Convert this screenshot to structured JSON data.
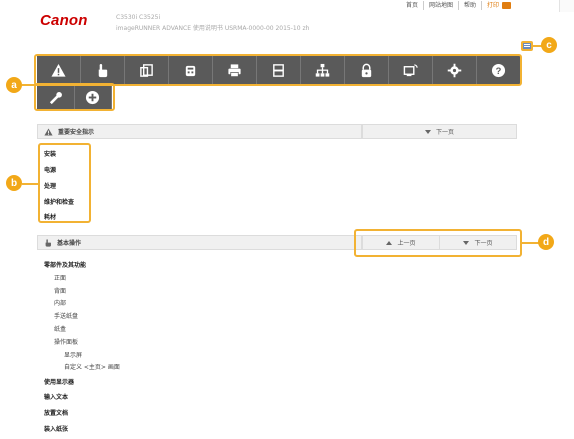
{
  "header": {
    "logo": "Canon",
    "model_line1": "C3530i  C3525i",
    "model_line2": "imageRUNNER ADVANCE  使用说明书  USRMA-0000-00  2015-10  zh",
    "links": [
      "首页",
      "网站地图",
      "帮助",
      "打印"
    ]
  },
  "toolbar": {
    "icons": [
      "warning-icon",
      "hand-icon",
      "copy-icon",
      "fax-icon",
      "print-icon",
      "scan-icon",
      "network-icon",
      "security-icon",
      "remote-ui-icon",
      "settings-icon",
      "help-icon"
    ],
    "row2_icons": [
      "wrench-icon",
      "plus-circle-icon"
    ]
  },
  "callouts": {
    "a": "a",
    "b": "b",
    "c": "c",
    "d": "d"
  },
  "section_safety": {
    "title": "重要安全指示",
    "next": "下一页",
    "items": [
      "安装",
      "电源",
      "处理",
      "维护和检查",
      "耗材"
    ]
  },
  "section_basic": {
    "title": "基本操作",
    "prev": "上一页",
    "next": "下一页",
    "items": [
      {
        "text": "零部件及其功能",
        "level": 0
      },
      {
        "text": "正面",
        "level": 1
      },
      {
        "text": "背面",
        "level": 1
      },
      {
        "text": "内部",
        "level": 1
      },
      {
        "text": "手送纸盘",
        "level": 1
      },
      {
        "text": "纸盒",
        "level": 1
      },
      {
        "text": "操作面板",
        "level": 1
      },
      {
        "text": "显示屏",
        "level": 2
      },
      {
        "text": "自定义 <主页> 画面",
        "level": 2
      },
      {
        "text": "使用显示器",
        "level": 0
      },
      {
        "text": "输入文本",
        "level": 0
      },
      {
        "text": "放置文档",
        "level": 0
      },
      {
        "text": "装入纸张",
        "level": 0
      }
    ]
  }
}
